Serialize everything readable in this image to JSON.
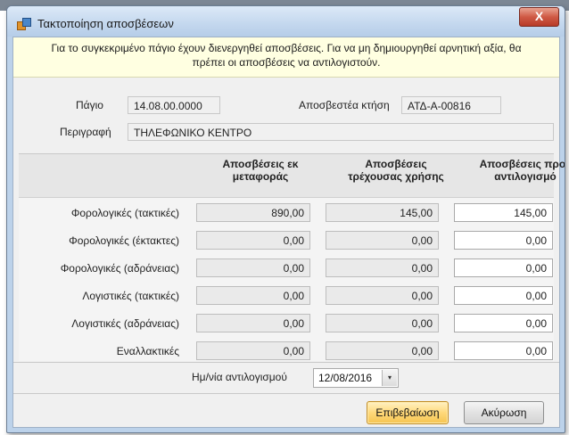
{
  "window": {
    "title": "Τακτοποίηση αποσβέσεων",
    "close_label": "X"
  },
  "info": {
    "line1": "Για το συγκεκριμένο πάγιο έχουν διενεργηθεί αποσβέσεις. Για να μη δημιουργηθεί αρνητική αξία, θα",
    "line2": "πρέπει οι αποσβέσεις να αντιλογιστούν."
  },
  "asset": {
    "pagio_label": "Πάγιο",
    "pagio_value": "14.08.00.0000",
    "ktisi_label": "Αποσβεστέα κτήση",
    "ktisi_value": "ΑΤΔ-Α-00816",
    "perigrafi_label": "Περιγραφή",
    "perigrafi_value": "ΤΗΛΕΦΩΝΙΚΟ ΚΕΝΤΡΟ"
  },
  "table": {
    "headers": [
      [
        "Αποσβέσεις εκ",
        "μεταφοράς"
      ],
      [
        "Αποσβέσεις",
        "τρέχουσας χρήσης"
      ],
      [
        "Αποσβέσεις προς",
        "αντιλογισμό"
      ]
    ],
    "rows": [
      {
        "label": "Φορολογικές (τακτικές)",
        "values": [
          "890,00",
          "145,00",
          "145,00"
        ]
      },
      {
        "label": "Φορολογικές (έκτακτες)",
        "values": [
          "0,00",
          "0,00",
          "0,00"
        ]
      },
      {
        "label": "Φορολογικές (αδράνειας)",
        "values": [
          "0,00",
          "0,00",
          "0,00"
        ]
      },
      {
        "label": "Λογιστικές (τακτικές)",
        "values": [
          "0,00",
          "0,00",
          "0,00"
        ]
      },
      {
        "label": "Λογιστικές (αδράνειας)",
        "values": [
          "0,00",
          "0,00",
          "0,00"
        ]
      },
      {
        "label": "Εναλλακτικές",
        "values": [
          "0,00",
          "0,00",
          "0,00"
        ]
      }
    ]
  },
  "date": {
    "label": "Ημ/νία αντιλογισμού",
    "value": "12/08/2016",
    "dropdown_icon": "▾"
  },
  "buttons": {
    "confirm": "Επιβεβαίωση",
    "cancel": "Ακύρωση"
  }
}
